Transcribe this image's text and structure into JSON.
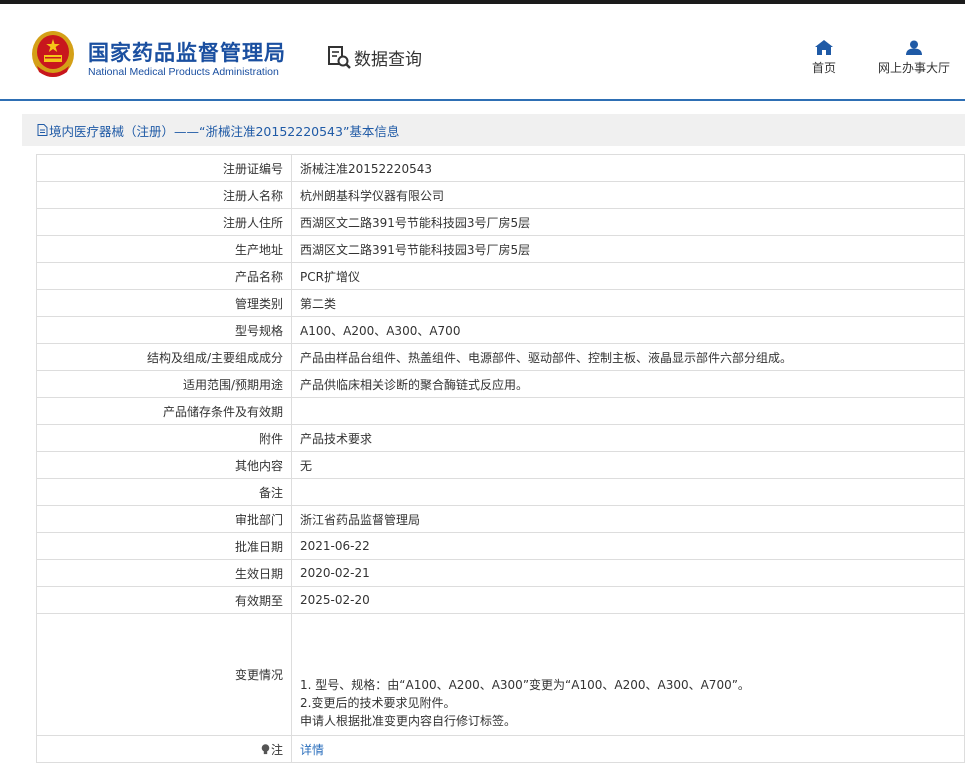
{
  "header": {
    "brand_cn": "国家药品监督管理局",
    "brand_en": "National Medical Products Administration",
    "query_label": "数据查询",
    "nav": [
      {
        "label": "首页",
        "icon": "home-icon"
      },
      {
        "label": "网上办事大厅",
        "icon": "user-icon"
      }
    ]
  },
  "breadcrumb": "境内医疗器械（注册）——“浙械注准20152220543”基本信息",
  "colors": {
    "brand": "#1a4fa0",
    "accent": "#2e6fb4",
    "link": "#2a6ebc"
  },
  "rows": [
    {
      "label": "注册证编号",
      "value": "浙械注准20152220543"
    },
    {
      "label": "注册人名称",
      "value": "杭州朗基科学仪器有限公司"
    },
    {
      "label": "注册人住所",
      "value": "西湖区文二路391号节能科技园3号厂房5层"
    },
    {
      "label": "生产地址",
      "value": "西湖区文二路391号节能科技园3号厂房5层"
    },
    {
      "label": "产品名称",
      "value": "PCR扩增仪"
    },
    {
      "label": "管理类别",
      "value": "第二类"
    },
    {
      "label": "型号规格",
      "value": "A100、A200、A300、A700"
    },
    {
      "label": "结构及组成/主要组成成分",
      "value": "产品由样品台组件、热盖组件、电源部件、驱动部件、控制主板、液晶显示部件六部分组成。"
    },
    {
      "label": "适用范围/预期用途",
      "value": "产品供临床相关诊断的聚合酶链式反应用。"
    },
    {
      "label": "产品储存条件及有效期",
      "value": ""
    },
    {
      "label": "附件",
      "value": "产品技术要求"
    },
    {
      "label": "其他内容",
      "value": "无"
    },
    {
      "label": "备注",
      "value": ""
    },
    {
      "label": "审批部门",
      "value": "浙江省药品监督管理局"
    },
    {
      "label": "批准日期",
      "value": "2021-06-22"
    },
    {
      "label": "生效日期",
      "value": "2020-02-21"
    },
    {
      "label": "有效期至",
      "value": "2025-02-20"
    }
  ],
  "change": {
    "label": "变更情况",
    "lines": [
      "1. 型号、规格：由“A100、A200、A300”变更为“A100、A200、A300、A700”。",
      "2.变更后的技术要求见附件。",
      "申请人根据批准变更内容自行修订标签。"
    ]
  },
  "note": {
    "label": "注",
    "icon": "lightbulb-icon",
    "link": "详情"
  }
}
